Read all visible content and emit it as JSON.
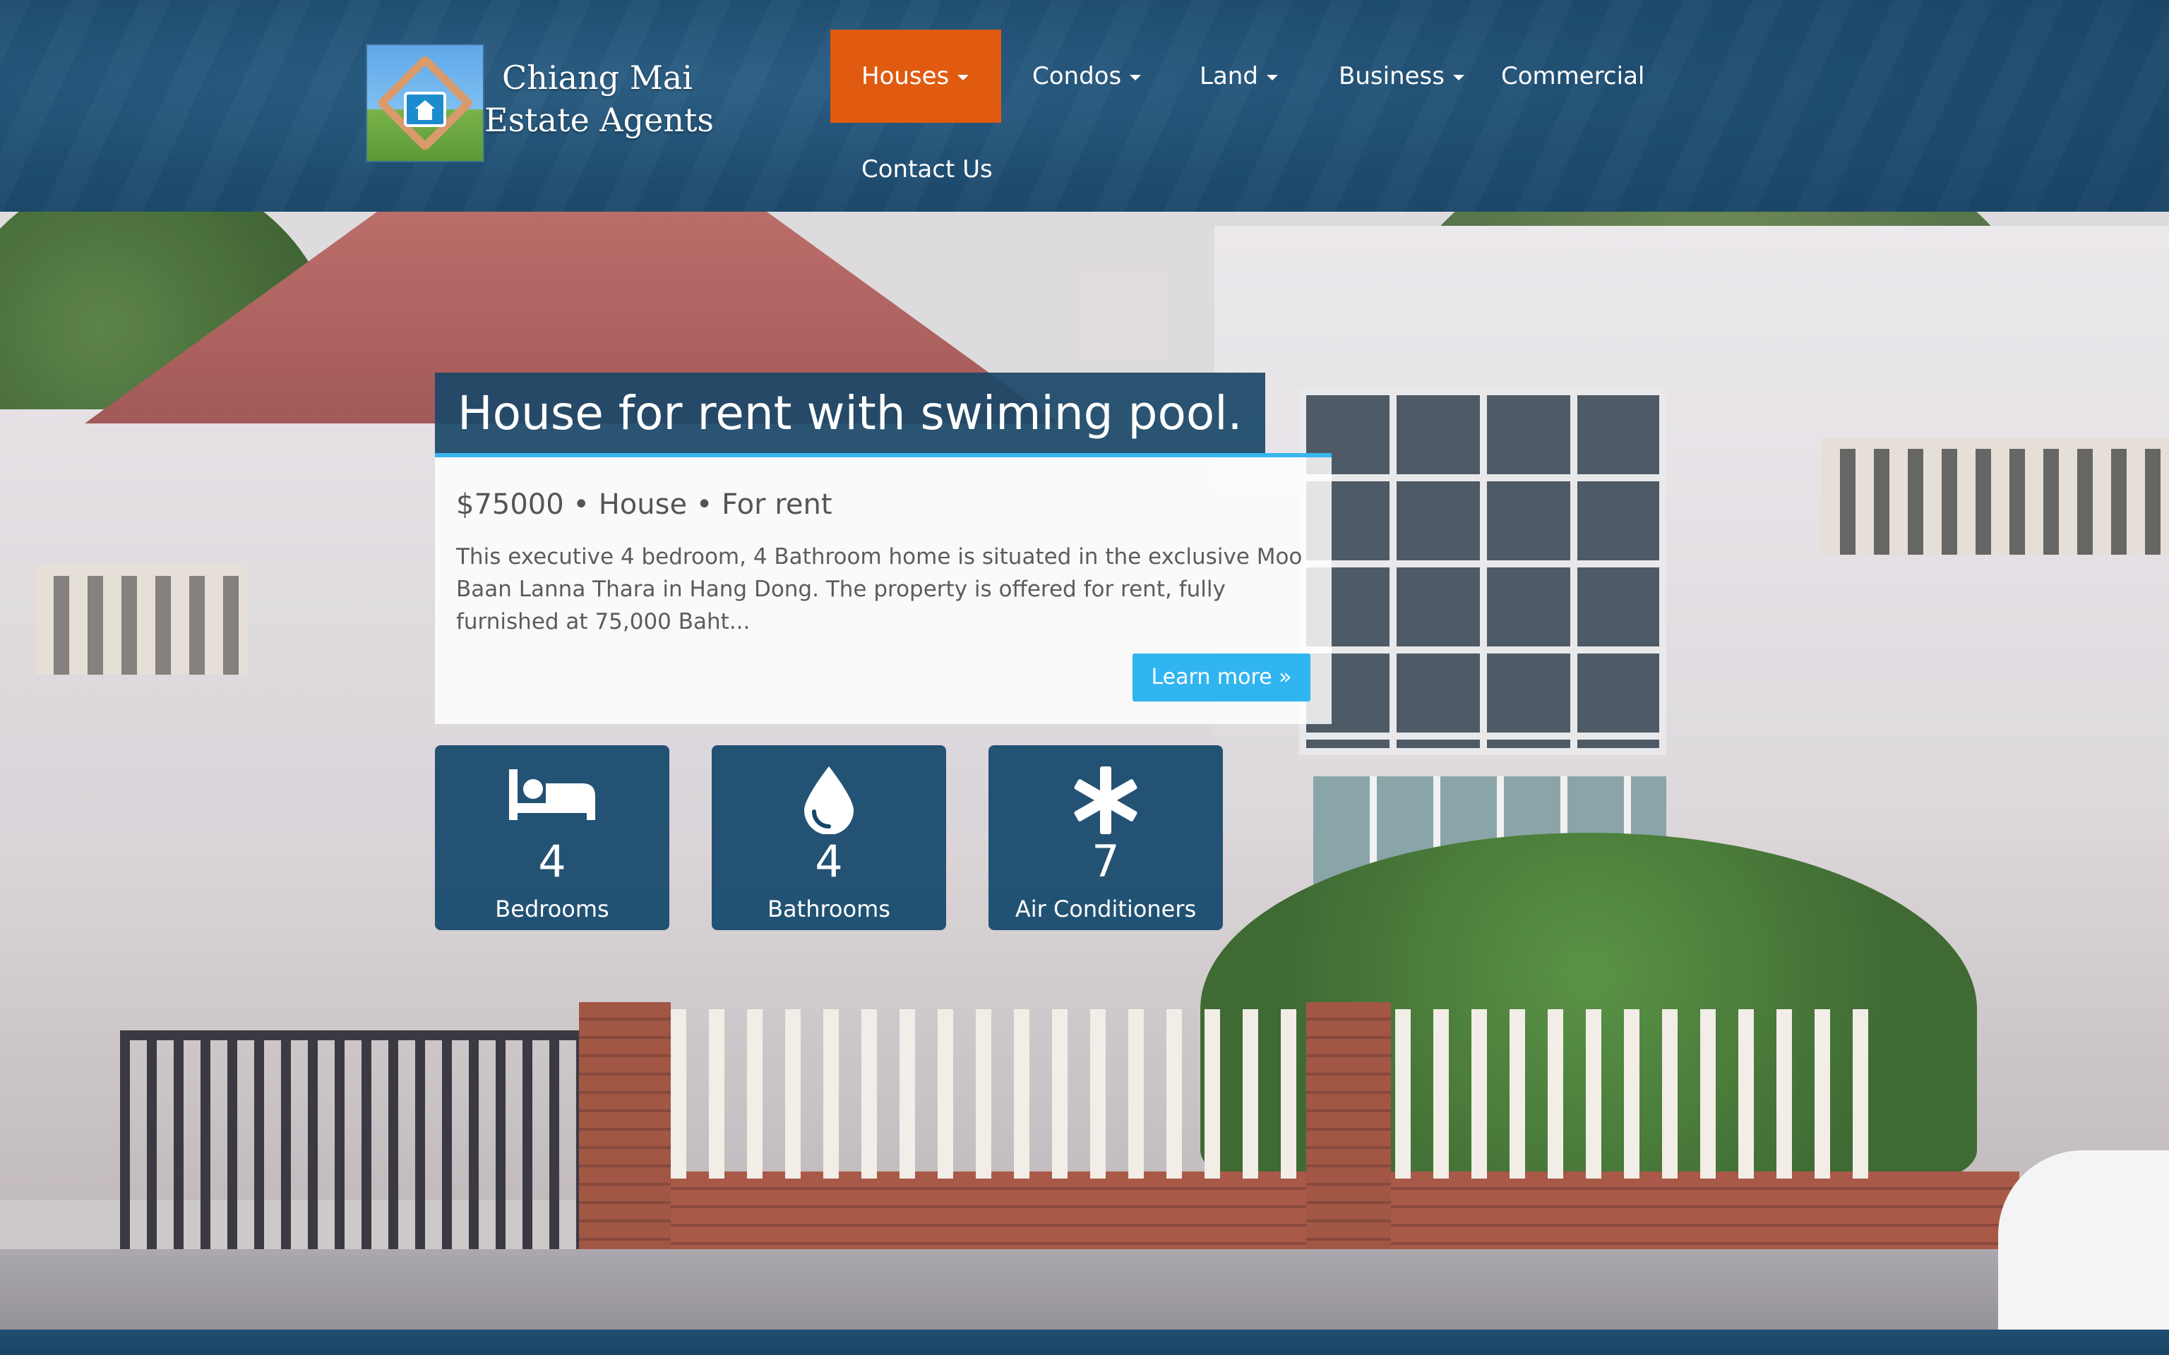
{
  "brand": {
    "logo_line1": "Chiang Mai",
    "logo_line2": "Estate Agents",
    "logo_icon": "house-in-hands-icon"
  },
  "nav": {
    "items": [
      {
        "label": "Houses",
        "dropdown": true,
        "active": true
      },
      {
        "label": "Condos",
        "dropdown": true,
        "active": false
      },
      {
        "label": "Land",
        "dropdown": true,
        "active": false
      },
      {
        "label": "Business",
        "dropdown": true,
        "active": false
      },
      {
        "label": "Commercial",
        "dropdown": false,
        "active": false
      },
      {
        "label": "Contact Us",
        "dropdown": false,
        "active": false
      }
    ]
  },
  "hero": {
    "title": "House for rent with swiming pool.",
    "subtitle": "$75000 • House • For rent",
    "description": "This executive 4 bedroom, 4 Bathroom home is situated in the exclusive Moo Baan Lanna Thara in Hang Dong. The property is offered for rent, fully furnished at 75,000 Baht...",
    "button_label": "Learn more »"
  },
  "features": [
    {
      "icon": "bed-icon",
      "value": "4",
      "label": "Bedrooms"
    },
    {
      "icon": "water-drop-icon",
      "value": "4",
      "label": "Bathrooms"
    },
    {
      "icon": "asterisk-icon",
      "value": "7",
      "label": "Air Conditioners"
    }
  ],
  "colors": {
    "header_bg": "#1f4d70",
    "nav_active": "#e05a10",
    "accent_blue": "#31b5f0",
    "card_bg": "#14486c"
  }
}
